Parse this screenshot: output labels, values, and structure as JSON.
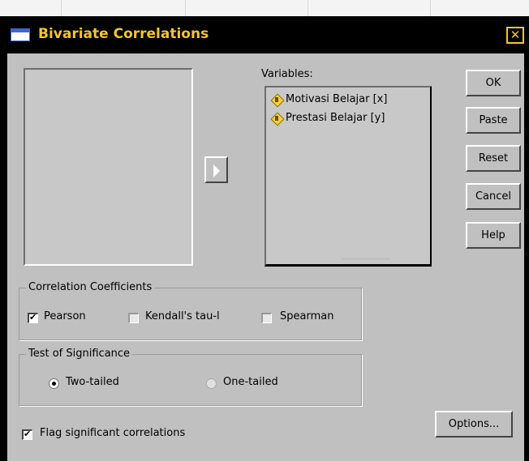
{
  "window": {
    "title": "Bivariate Correlations",
    "close_glyph": "✕"
  },
  "variables_label": "Variables:",
  "variables": [
    {
      "label": "Motivasi Belajar [x]",
      "icon": "scale-variable-icon"
    },
    {
      "label": "Prestasi Belajar [y]",
      "icon": "scale-variable-icon"
    }
  ],
  "buttons": {
    "ok": "OK",
    "paste": "Paste",
    "reset": "Reset",
    "cancel": "Cancel",
    "help": "Help",
    "options": "Options..."
  },
  "correlation_coefficients": {
    "legend": "Correlation Coefficients",
    "pearson": {
      "label": "Pearson",
      "checked": true
    },
    "kendall": {
      "label": "Kendall's tau-l",
      "checked": false
    },
    "spearman": {
      "label": "Spearman",
      "checked": false
    }
  },
  "test_of_significance": {
    "legend": "Test of Significance",
    "two_tailed": {
      "label": "Two-tailed",
      "selected": true
    },
    "one_tailed": {
      "label": "One-tailed",
      "selected": false
    }
  },
  "flag_significant": {
    "label": "Flag significant correlations",
    "checked": true
  },
  "colors": {
    "title_text": "#f4c430",
    "title_bar": "#000000",
    "dialog_body": "#c0c0c0"
  }
}
